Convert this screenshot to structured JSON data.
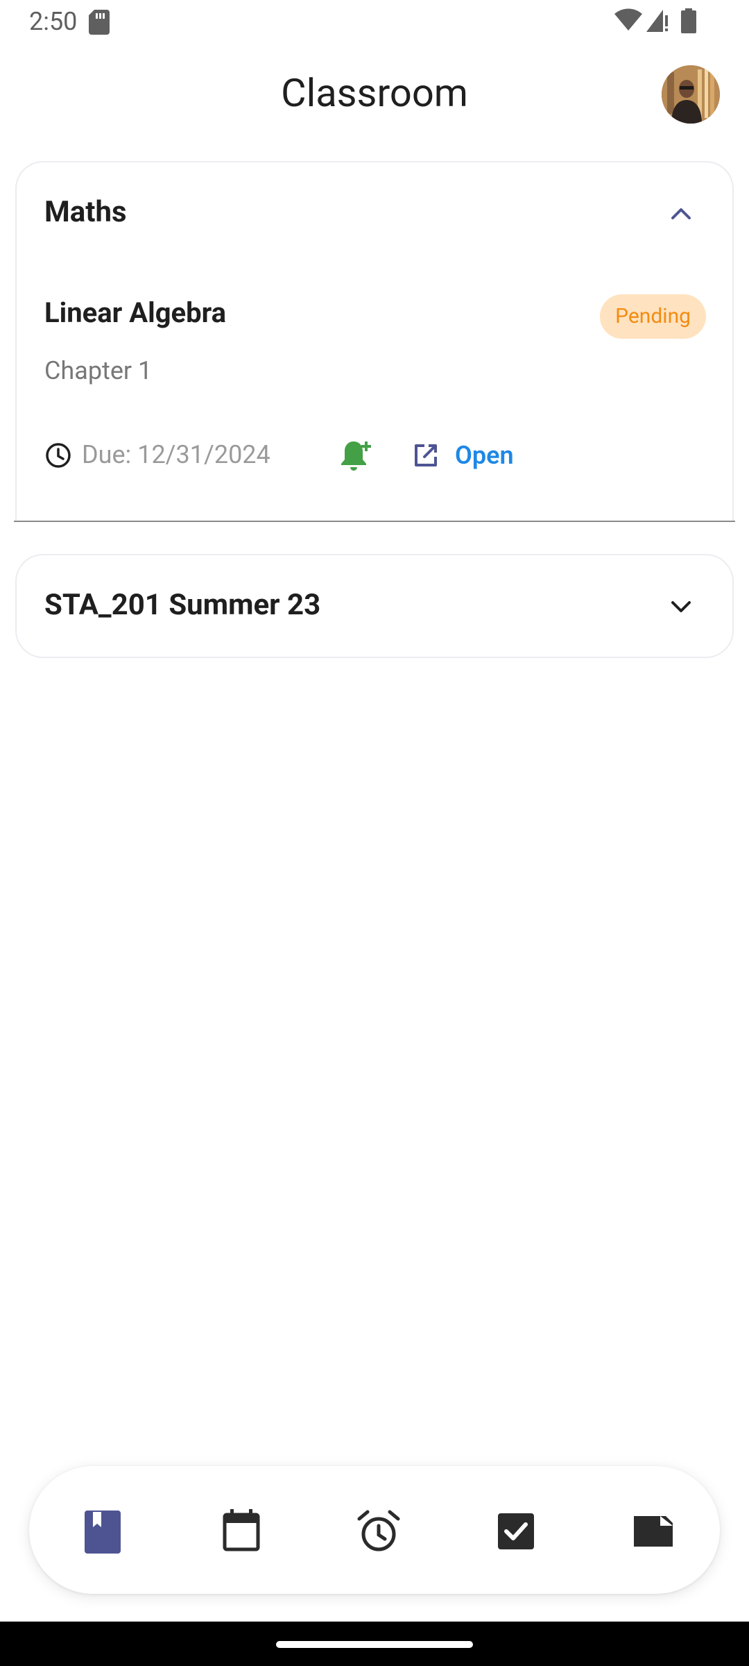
{
  "status_bar": {
    "time": "2:50"
  },
  "header": {
    "title": "Classroom"
  },
  "courses": [
    {
      "name": "Maths",
      "expanded": true,
      "assignments": [
        {
          "title": "Linear Algebra",
          "status": "Pending",
          "chapter": "Chapter 1",
          "due": "Due: 12/31/2024",
          "open_label": "Open"
        }
      ]
    },
    {
      "name": "STA_201 Summer 23",
      "expanded": false
    }
  ],
  "bottom_nav": {
    "items": [
      {
        "icon": "bookmark-book-icon",
        "active": true
      },
      {
        "icon": "calendar-icon",
        "active": false
      },
      {
        "icon": "alarm-clock-icon",
        "active": false
      },
      {
        "icon": "checkbox-icon",
        "active": false
      },
      {
        "icon": "note-icon",
        "active": false
      }
    ]
  },
  "colors": {
    "accent": "#4e5492",
    "pending_bg": "#ffe2bf",
    "pending_text": "#f28c12",
    "link_blue": "#1e88e5",
    "bell_green": "#43a047"
  }
}
